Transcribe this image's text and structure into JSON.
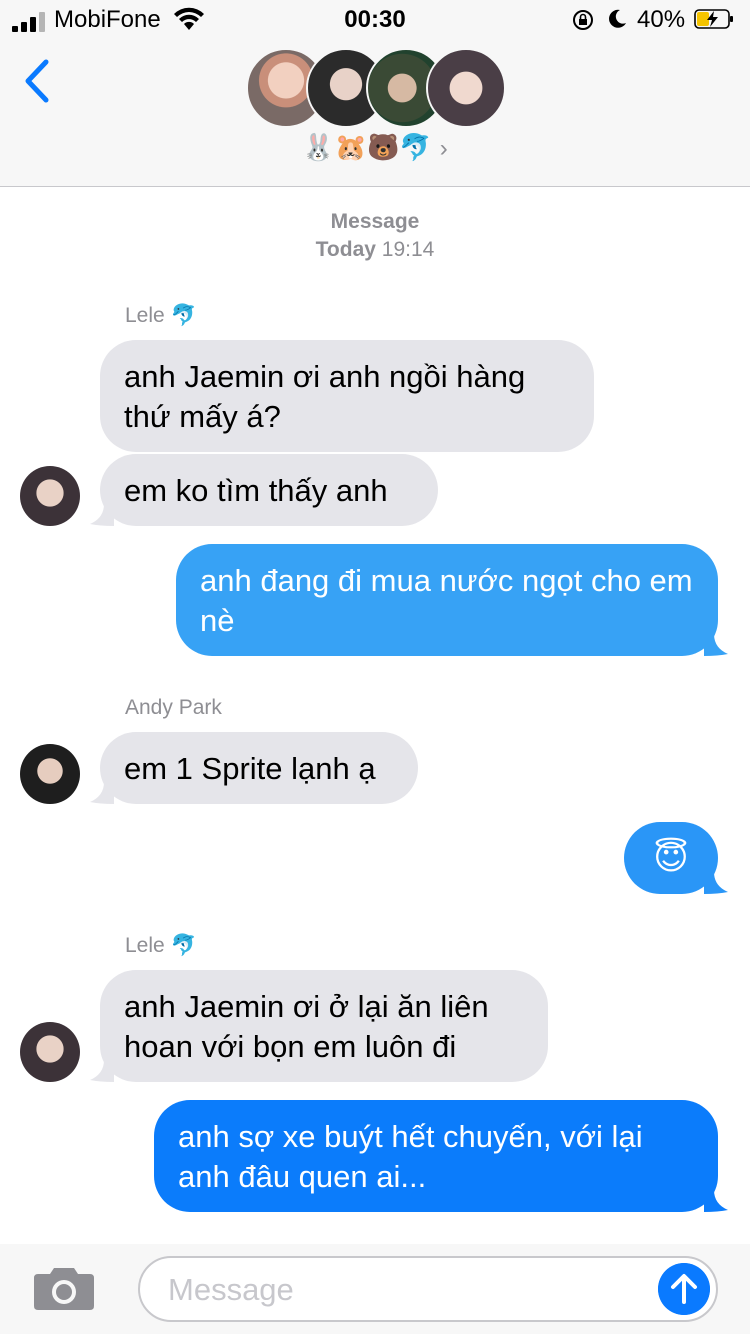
{
  "status_bar": {
    "carrier": "MobiFone",
    "time": "00:30",
    "battery_percent": "40%",
    "battery_level": 0.4,
    "icons": [
      "signal-icon",
      "wifi-icon",
      "orientation-lock-icon",
      "moon-icon",
      "battery-charging-icon"
    ]
  },
  "header": {
    "back_icon": "chevron-left-icon",
    "group_name": "🐰🐹🐻🐬",
    "details_chevron": "›",
    "participant_count": 4
  },
  "thread": {
    "timestamp_label": "Message",
    "timestamp_day": "Today",
    "timestamp_time": "19:14",
    "messages": [
      {
        "sender": "Lele 🐬",
        "text": "anh Jaemin ơi anh ngồi hàng thứ mấy á?",
        "direction": "incoming"
      },
      {
        "text": "em ko tìm thấy anh",
        "direction": "incoming"
      },
      {
        "text": "anh đang đi mua nước ngọt cho em nè",
        "direction": "outgoing"
      },
      {
        "sender": "Andy Park",
        "text": "em 1 Sprite lạnh ạ",
        "direction": "incoming"
      },
      {
        "text": "😇",
        "direction": "outgoing"
      },
      {
        "sender": "Lele 🐬",
        "text": "anh Jaemin ơi ở lại ăn liên hoan với bọn em luôn đi",
        "direction": "incoming"
      },
      {
        "text": "anh sợ xe buýt hết chuyến, với lại anh đâu quen ai...",
        "direction": "outgoing"
      }
    ]
  },
  "composer": {
    "placeholder": "Message",
    "camera_icon": "camera-icon",
    "send_icon": "arrow-up-icon"
  },
  "colors": {
    "incoming_bubble": "#e5e5ea",
    "outgoing_bubble_top": "#36a6f7",
    "outgoing_bubble_bottom": "#0a7aff",
    "accent": "#0a7aff",
    "secondary_text": "#8e8e93"
  }
}
